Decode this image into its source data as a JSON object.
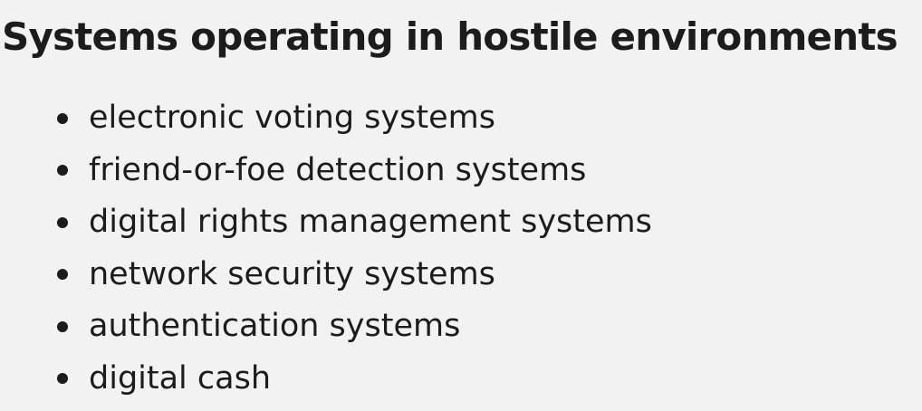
{
  "title": "Systems operating in hostile environments",
  "items": [
    "electronic voting systems",
    "friend-or-foe detection systems",
    "digital rights management systems",
    "network security systems",
    "authentication systems",
    "digital cash"
  ]
}
